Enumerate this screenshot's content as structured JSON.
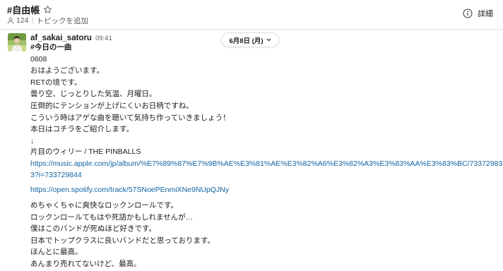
{
  "channel": {
    "name": "#自由帳",
    "member_count": "124",
    "add_topic": "トピックを追加",
    "details_label": "詳細"
  },
  "message": {
    "username": "af_sakai_satoru",
    "timestamp": "09:41",
    "date_label": "6月8日 (月)",
    "block1": [
      "#今日の一曲",
      "0608",
      "おはようございます。",
      "RETの境です。",
      "曇り空、じっとりした気温、月曜日。",
      "圧倒的にテンションが上げにくいお日柄ですね。",
      "こういう時はアゲな曲を聴いて気持ち作っていきましょう！",
      "本日はコチラをご紹介します。",
      "↓"
    ],
    "song_line": "片目のウィリー / THE PINBALLS",
    "apple_link_line1": "https://music.apple.com/jp/album/%E7%89%87%E7%9B%AE%E3%81%AE%E3%82%A6%E3%82%A3%E3%83%AA%E3%83%BC/73372983",
    "apple_link_line2": "3?i=733729844",
    "spotify_link": "https://open.spotify.com/track/57SNoePEnmiXNe9NUpQJNy",
    "block2": [
      "めちゃくちゃに爽快なロックンロールです。",
      "ロックンロールてもはや死語かもしれませんが…",
      "僕はこのバンドが死ぬほど好きです。",
      "日本でトップクラスに良いバンドだと思っております。",
      "ほんとに最高。",
      "あんまり売れてないけど、最高。"
    ]
  }
}
